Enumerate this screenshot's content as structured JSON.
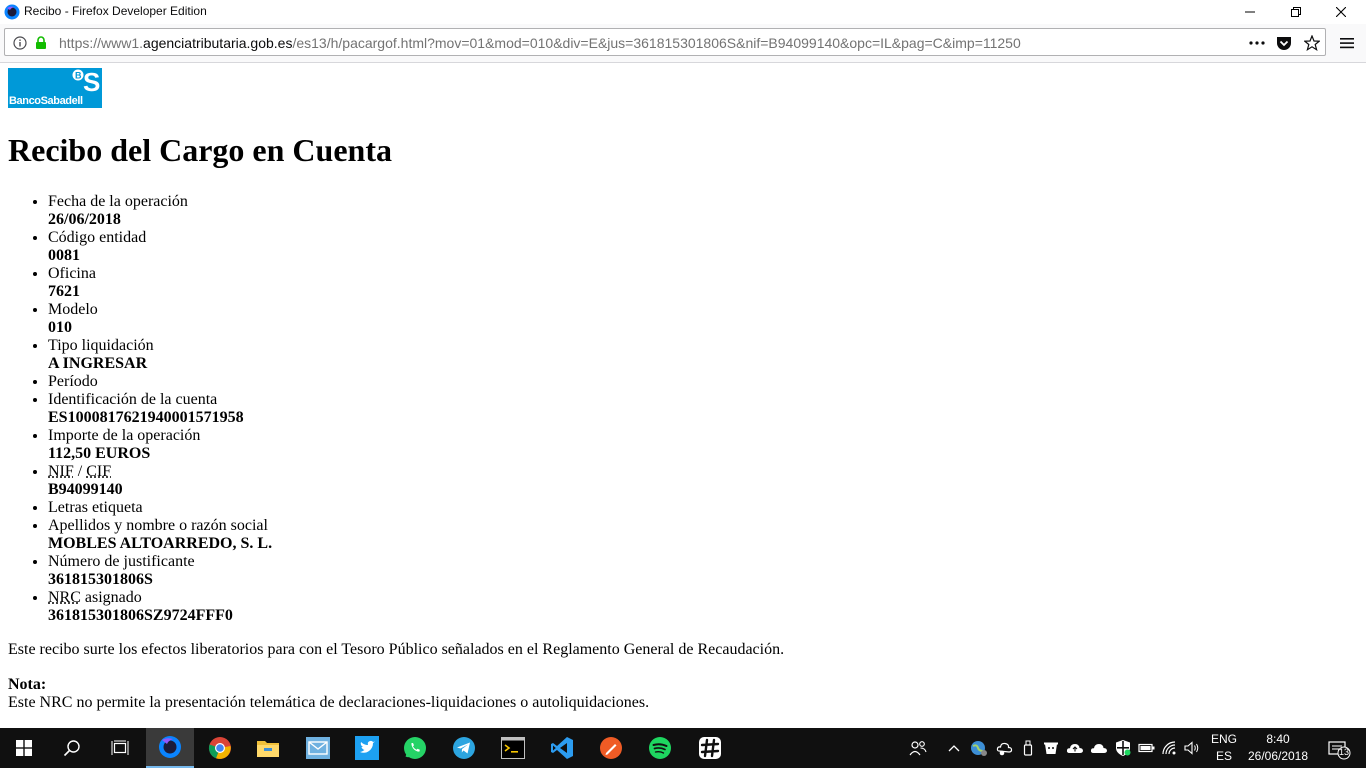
{
  "window": {
    "title": "Recibo - Firefox Developer Edition"
  },
  "urlbar": {
    "url_prefix": "https://www1.",
    "url_host": "agenciatributaria.gob.es",
    "url_path": "/es13/h/pacargof.html?mov=01&mod=010&div=E&jus=361815301806S&nif=B94099140&opc=IL&pag=C&imp=11250"
  },
  "page": {
    "logo_text": "BancoSabadell",
    "heading": "Recibo del Cargo en Cuenta",
    "fields": [
      {
        "label": "Fecha de la operación",
        "value": "26/06/2018"
      },
      {
        "label": "Código entidad",
        "value": "0081"
      },
      {
        "label": "Oficina",
        "value": "7621"
      },
      {
        "label": "Modelo",
        "value": "010"
      },
      {
        "label": "Tipo liquidación",
        "value": "A INGRESAR"
      },
      {
        "label": "Período",
        "value": ""
      },
      {
        "label": "Identificación de la cuenta",
        "value": "ES1000817621940001571958"
      },
      {
        "label": "Importe de la operación",
        "value": "112,50 EUROS"
      },
      {
        "label_abbr1": "NIF",
        "label_sep": " / ",
        "label_abbr2": "CIF",
        "value": "B94099140"
      },
      {
        "label": "Letras etiqueta",
        "value": ""
      },
      {
        "label": "Apellidos y nombre o razón social",
        "value": "MOBLES ALTOARREDO, S. L."
      },
      {
        "label": "Número de justificante",
        "value": "361815301806S"
      },
      {
        "label_abbr": "NRC",
        "label_rest": " asignado",
        "value": "361815301806SZ9724FFF0"
      }
    ],
    "legal_text": "Este recibo surte los efectos liberatorios para con el Tesoro Público señalados en el Reglamento General de Recaudación.",
    "nota_label": "Nota:",
    "nota_text": "Este NRC no permite la presentación telemática de declaraciones-liquidaciones o autoliquidaciones."
  },
  "taskbar": {
    "apps": [
      "start",
      "search",
      "task-view",
      "firefox-developer",
      "chrome",
      "file-explorer",
      "mail",
      "twitter",
      "whatsapp",
      "telegram",
      "terminal",
      "vscode",
      "postman",
      "spotify",
      "slack"
    ],
    "lang_top": "ENG",
    "lang_bottom": "ES",
    "time": "8:40",
    "date": "26/06/2018",
    "notifications_count": "13"
  },
  "colors": {
    "accent": "#0099d8",
    "taskbar_bg": "#101010",
    "lock_green": "#12bc00"
  }
}
